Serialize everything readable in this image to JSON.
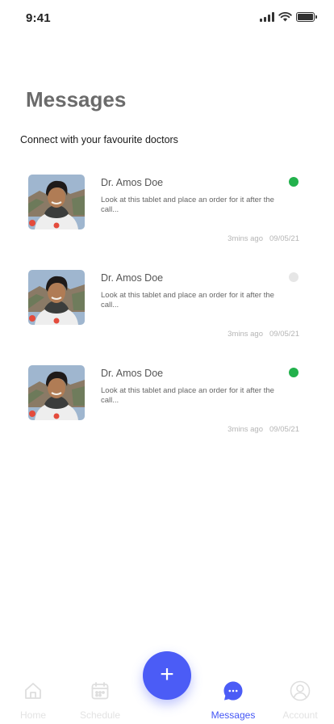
{
  "status_bar": {
    "time": "9:41"
  },
  "header": {
    "title": "Messages",
    "subtitle": "Connect with your favourite doctors"
  },
  "messages": [
    {
      "name": "Dr. Amos Doe",
      "text": "Look at this tablet and place an order for it after the call...",
      "ago": "3mins ago",
      "date": "09/05/21",
      "online": true
    },
    {
      "name": "Dr. Amos Doe",
      "text": "Look at this tablet and place an order for it after the call...",
      "ago": "3mins ago",
      "date": "09/05/21",
      "online": false
    },
    {
      "name": "Dr. Amos Doe",
      "text": "Look at this tablet and place an order for it after the call...",
      "ago": "3mins ago",
      "date": "09/05/21",
      "online": true
    }
  ],
  "nav": {
    "items": [
      {
        "label": "Home",
        "icon": "home-icon",
        "active": false
      },
      {
        "label": "Schedule",
        "icon": "calendar-icon",
        "active": false
      },
      {
        "label": "Messages",
        "icon": "chat-icon",
        "active": true
      },
      {
        "label": "Account",
        "icon": "user-icon",
        "active": false
      }
    ],
    "fab_icon": "plus-icon"
  },
  "colors": {
    "accent": "#4b5cf6",
    "active_label": "#4355f5",
    "online": "#22b14c",
    "offline": "#e6e6e6",
    "inactive_nav": "#e3e3e3"
  }
}
